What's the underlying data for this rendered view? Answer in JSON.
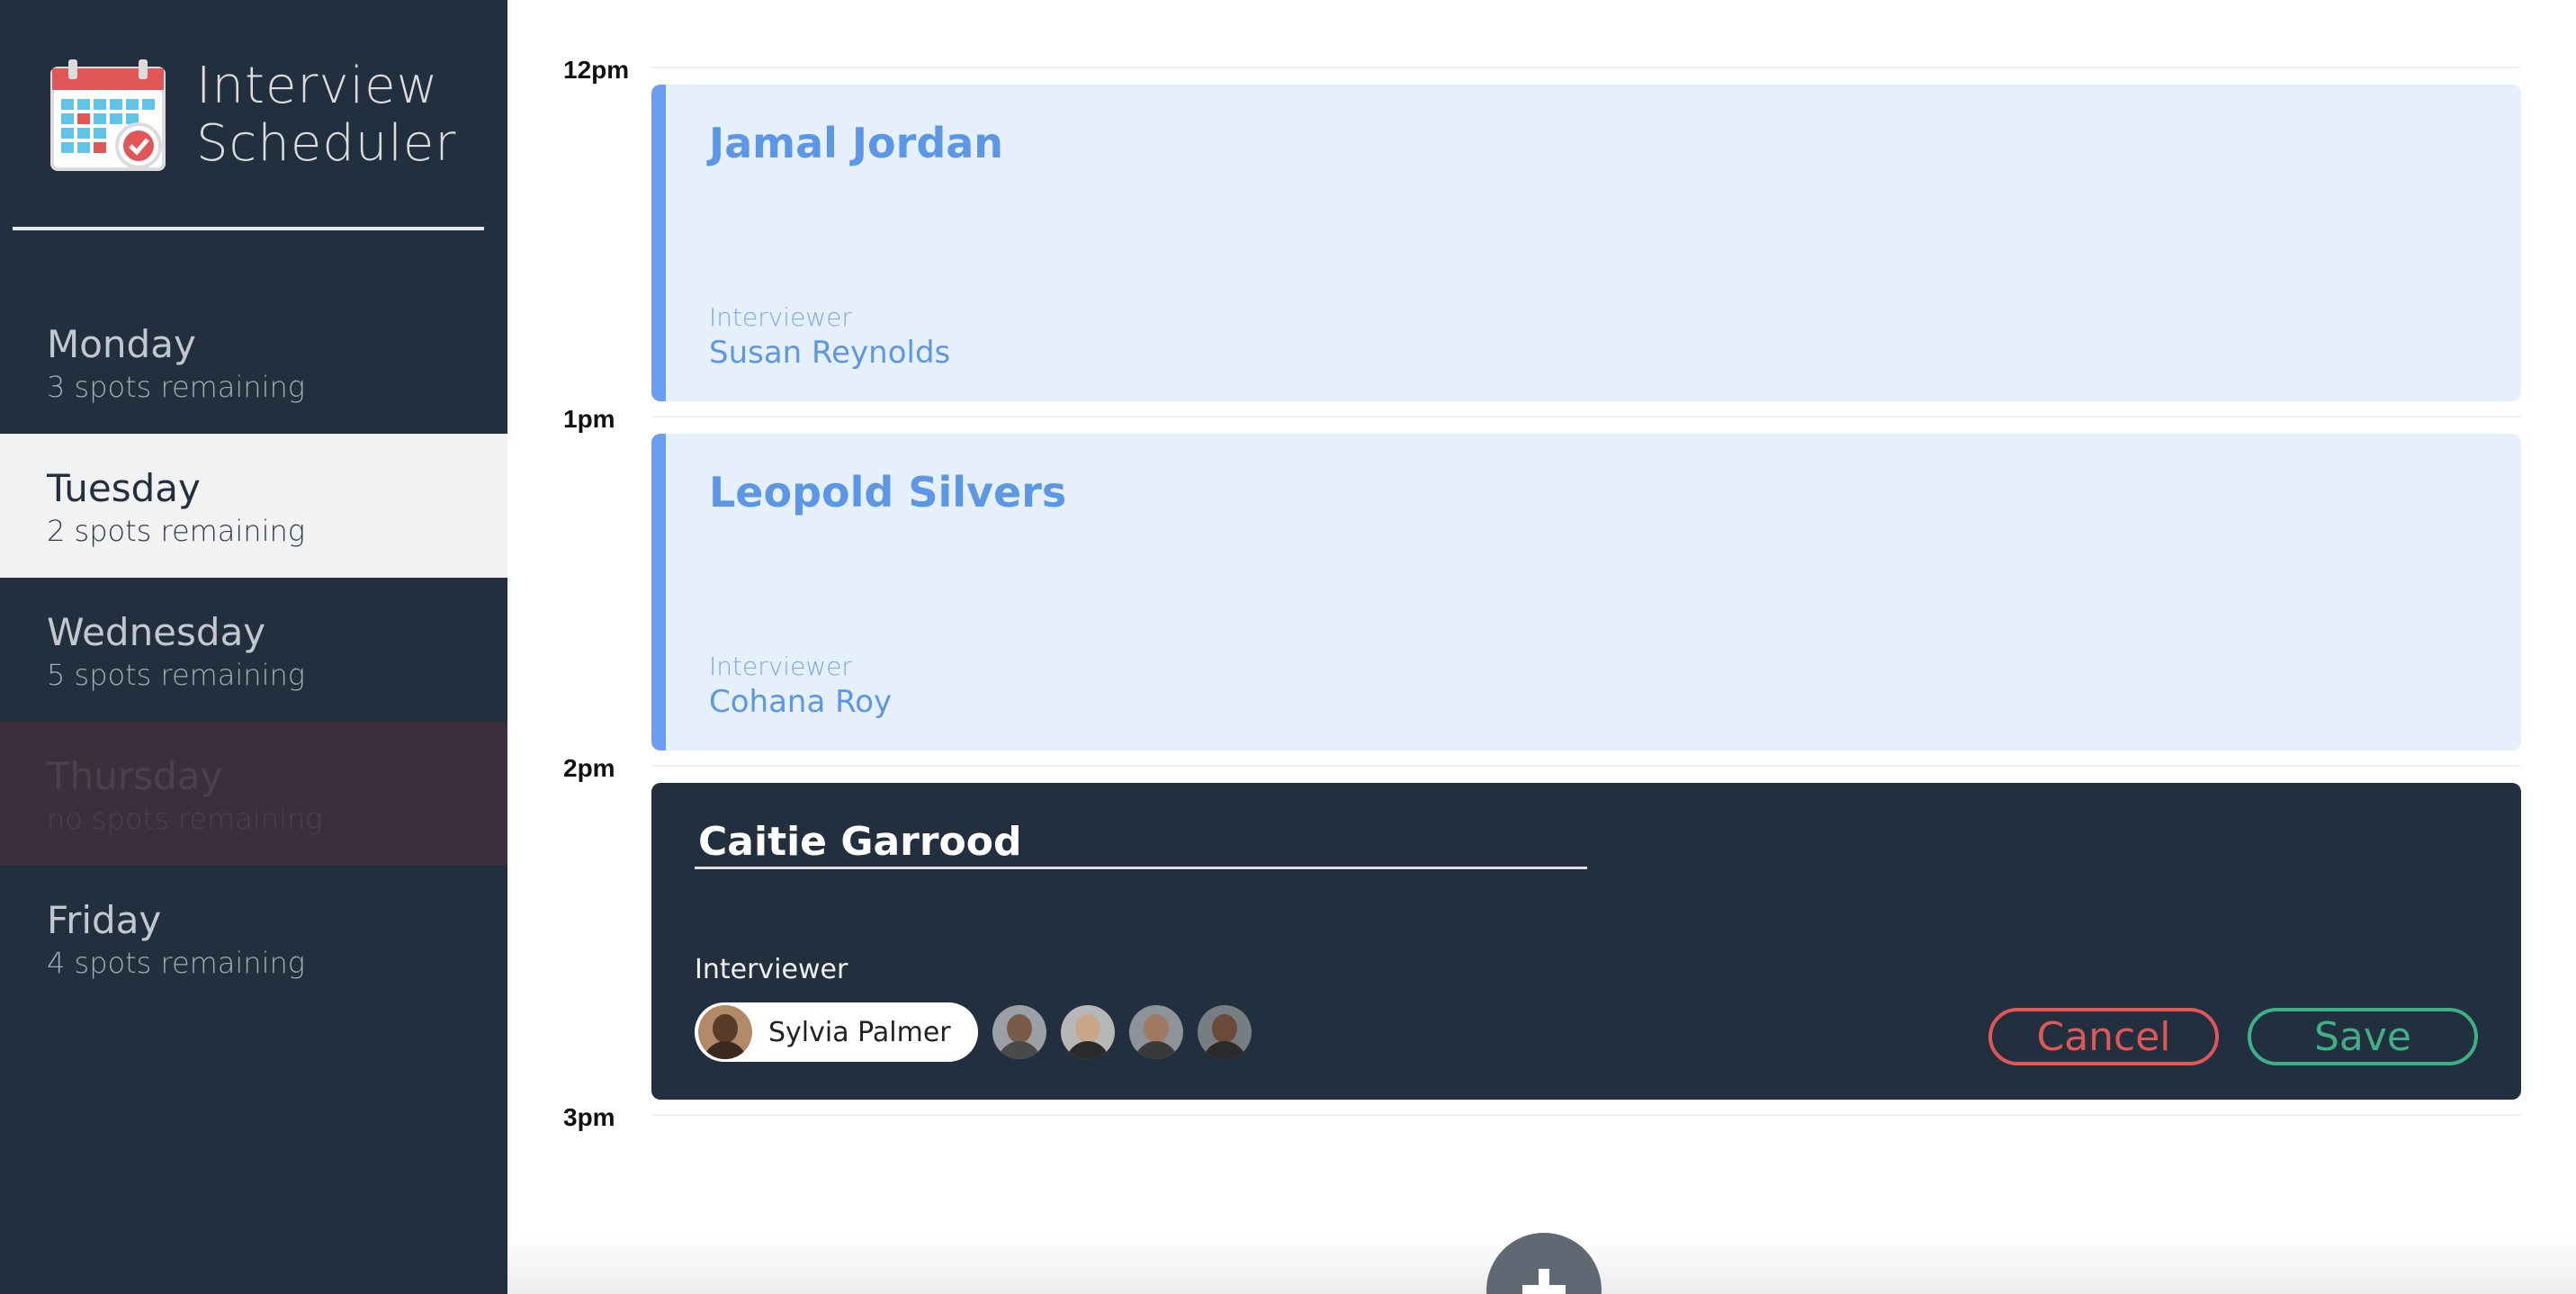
{
  "app": {
    "title_line1": "Interview",
    "title_line2": "Scheduler",
    "logo_icon": "calendar-check-icon"
  },
  "sidebar": {
    "days": [
      {
        "name": "Monday",
        "spots": "3 spots remaining",
        "state": "normal"
      },
      {
        "name": "Tuesday",
        "spots": "2 spots remaining",
        "state": "selected"
      },
      {
        "name": "Wednesday",
        "spots": "5 spots remaining",
        "state": "normal"
      },
      {
        "name": "Thursday",
        "spots": "no spots remaining",
        "state": "full"
      },
      {
        "name": "Friday",
        "spots": "4 spots remaining",
        "state": "normal"
      }
    ]
  },
  "schedule": {
    "times": [
      "12pm",
      "1pm",
      "2pm",
      "3pm"
    ],
    "appointments": [
      {
        "student": "Jamal Jordan",
        "interviewer_label": "Interviewer",
        "interviewer": "Susan Reynolds"
      },
      {
        "student": "Leopold Silvers",
        "interviewer_label": "Interviewer",
        "interviewer": "Cohana Roy"
      }
    ],
    "editor": {
      "student_name": "Caitie Garrood",
      "interviewer_label": "Interviewer",
      "selected_interviewer": "Sylvia Palmer",
      "cancel_label": "Cancel",
      "save_label": "Save"
    }
  },
  "colors": {
    "sidebar_bg": "#222f3e",
    "appointment_bg": "#e6f0fd",
    "appointment_accent": "#6b9ef0",
    "cancel": "#e15757",
    "save": "#3fb085"
  },
  "add_button_icon": "plus-icon"
}
